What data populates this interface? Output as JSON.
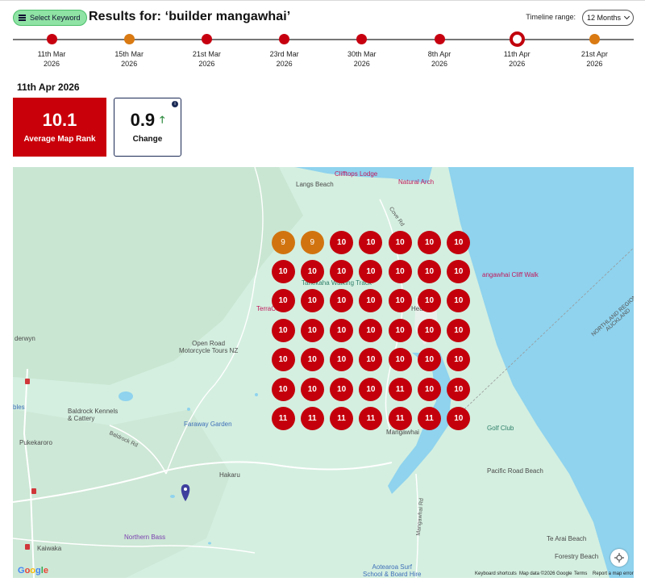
{
  "header": {
    "keyword_button": "Select Keyword",
    "title": "Results for: ‘builder mangawhai’",
    "timeline_range_label": "Timeline range:",
    "timeline_range_value": "12 Months"
  },
  "timeline": {
    "points": [
      {
        "day": "11th Mar",
        "year": "2026",
        "color": "#c70010"
      },
      {
        "day": "15th Mar",
        "year": "2026",
        "color": "#d97a12"
      },
      {
        "day": "21st Mar",
        "year": "2026",
        "color": "#c70010"
      },
      {
        "day": "23rd Mar",
        "year": "2026",
        "color": "#c70010"
      },
      {
        "day": "30th Mar",
        "year": "2026",
        "color": "#c70010"
      },
      {
        "day": "8th Apr",
        "year": "2026",
        "color": "#c70010"
      },
      {
        "day": "11th Apr",
        "year": "2026",
        "color": "#c70010",
        "selected": true
      },
      {
        "day": "21st Apr",
        "year": "2026",
        "color": "#d97a12"
      }
    ]
  },
  "selected_date": "11th Apr 2026",
  "stats": {
    "average_rank": {
      "value": "10.1",
      "label": "Average Map Rank"
    },
    "change": {
      "value": "0.9",
      "label": "Change",
      "info": "i"
    }
  },
  "colors": {
    "rank_red": "#c4000c",
    "rank_orange": "#d1740f",
    "accent_green": "#8fe3a4"
  },
  "map": {
    "grid": [
      [
        "9",
        "9",
        "10",
        "10",
        "10",
        "10",
        "10"
      ],
      [
        "10",
        "10",
        "10",
        "10",
        "10",
        "10",
        "10"
      ],
      [
        "10",
        "10",
        "10",
        "10",
        "10",
        "10",
        "10"
      ],
      [
        "10",
        "10",
        "10",
        "10",
        "10",
        "10",
        "10"
      ],
      [
        "10",
        "10",
        "10",
        "10",
        "10",
        "10",
        "10"
      ],
      [
        "10",
        "10",
        "10",
        "10",
        "11",
        "10",
        "10"
      ],
      [
        "11",
        "11",
        "11",
        "11",
        "11",
        "11",
        "10"
      ]
    ],
    "labels": {
      "langs_beach": "Langs Beach",
      "clifftops_lodge": "Clifftops Lodge",
      "natural_arch": "Natural Arch",
      "cove_rd": "Cove Rd",
      "cliff_walk": "angawhai Cliff Walk",
      "tanekaha": "Tanekaha Walking Track",
      "terracot": "TerraCot",
      "heads": "Heads",
      "open_road": "Open Road\nMotorcycle Tours NZ",
      "derwyn": "derwyn",
      "baldrock": "Baldrock Kennels\n& Cattery",
      "bles": "bles",
      "faraway": "Faraway Garden",
      "golf": "Golf Club",
      "mangawhai": "Mangawhai",
      "pukekaroro": "Pukekaroro",
      "baldrock_rd": "Baldrock Rd",
      "hakaru": "Hakaru",
      "pacific_road_beach": "Pacific Road Beach",
      "northern_bass": "Northern Bass",
      "te_arai": "Te Arai Beach",
      "forestry": "Forestry Beach",
      "kaiwaka": "Kaiwaka",
      "aotearoa": "Aotearoa Surf\nSchool & Board Hire",
      "mangawhai_rd": "Mangawhai Rd",
      "coast_line": "NORTHLAND REGION\nAUCKLAND",
      "shortcuts": "Keyboard shortcuts",
      "mapdata": "Map data ©2026 Google",
      "terms": "Terms",
      "report": "Report a map error",
      "google": "Google"
    }
  }
}
